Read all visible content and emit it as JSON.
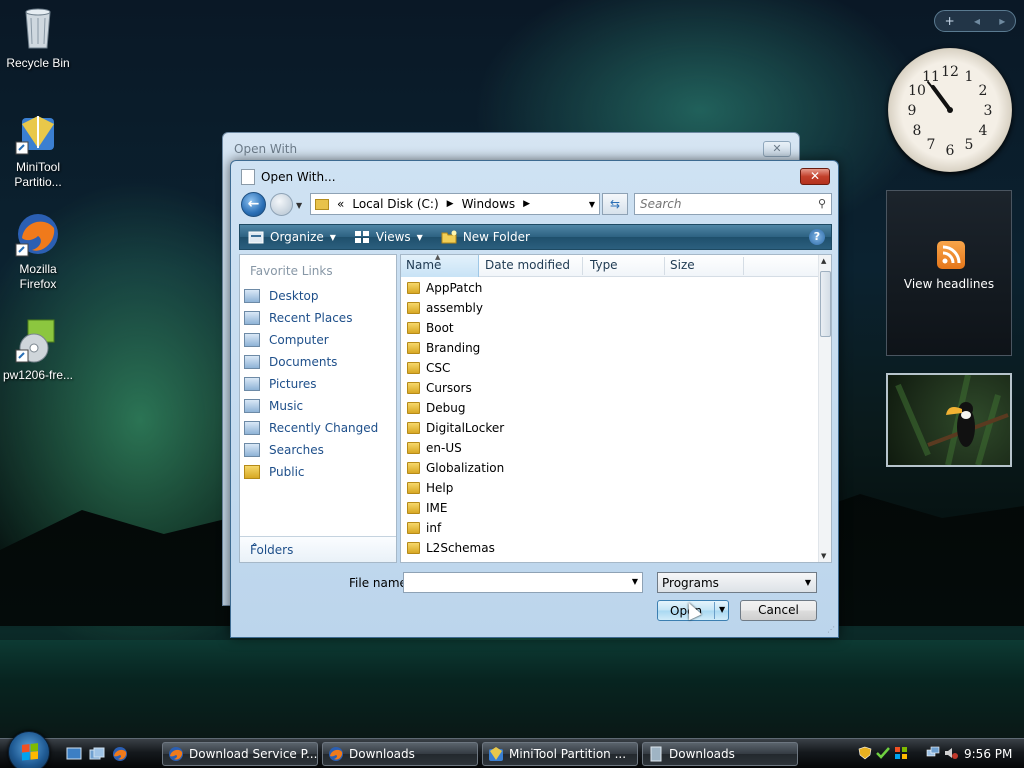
{
  "desktop": {
    "icons": [
      {
        "label": "Recycle Bin"
      },
      {
        "label": "MiniTool Partitio..."
      },
      {
        "label": "Mozilla Firefox"
      },
      {
        "label": "pw1206-fre..."
      }
    ]
  },
  "gadgets": {
    "feed_label": "View headlines",
    "clock_numbers": [
      "12",
      "1",
      "2",
      "3",
      "4",
      "5",
      "6",
      "7",
      "8",
      "9",
      "10",
      "11"
    ]
  },
  "back_dialog": {
    "title": "Open With",
    "close_label": "✕"
  },
  "dialog": {
    "title": "Open With...",
    "close_label": "✕",
    "address": {
      "prefix": "«",
      "segments": [
        "Local Disk (C:)",
        "Windows"
      ]
    },
    "search_placeholder": "Search",
    "toolbar": {
      "organize": "Organize",
      "views": "Views",
      "new_folder": "New Folder",
      "help": "?"
    },
    "favorite_links_header": "Favorite Links",
    "favorites": [
      "Desktop",
      "Recent Places",
      "Computer",
      "Documents",
      "Pictures",
      "Music",
      "Recently Changed",
      "Searches",
      "Public"
    ],
    "folders_label": "Folders",
    "columns": [
      "Name",
      "Date modified",
      "Type",
      "Size"
    ],
    "files": [
      "AppPatch",
      "assembly",
      "Boot",
      "Branding",
      "CSC",
      "Cursors",
      "Debug",
      "DigitalLocker",
      "en-US",
      "Globalization",
      "Help",
      "IME",
      "inf",
      "L2Schemas"
    ],
    "file_name_label": "File name:",
    "file_name_value": "",
    "file_type": "Programs",
    "open_label": "Open",
    "cancel_label": "Cancel"
  },
  "taskbar": {
    "tasks": [
      {
        "label": "Download Service P..."
      },
      {
        "label": "Downloads"
      },
      {
        "label": "MiniTool Partition ..."
      },
      {
        "label": "Downloads"
      }
    ],
    "time": "9:56 PM"
  },
  "colors": {
    "link": "#1e4f8a",
    "toolbar": "#2d6181",
    "close_red": "#c2402b"
  }
}
